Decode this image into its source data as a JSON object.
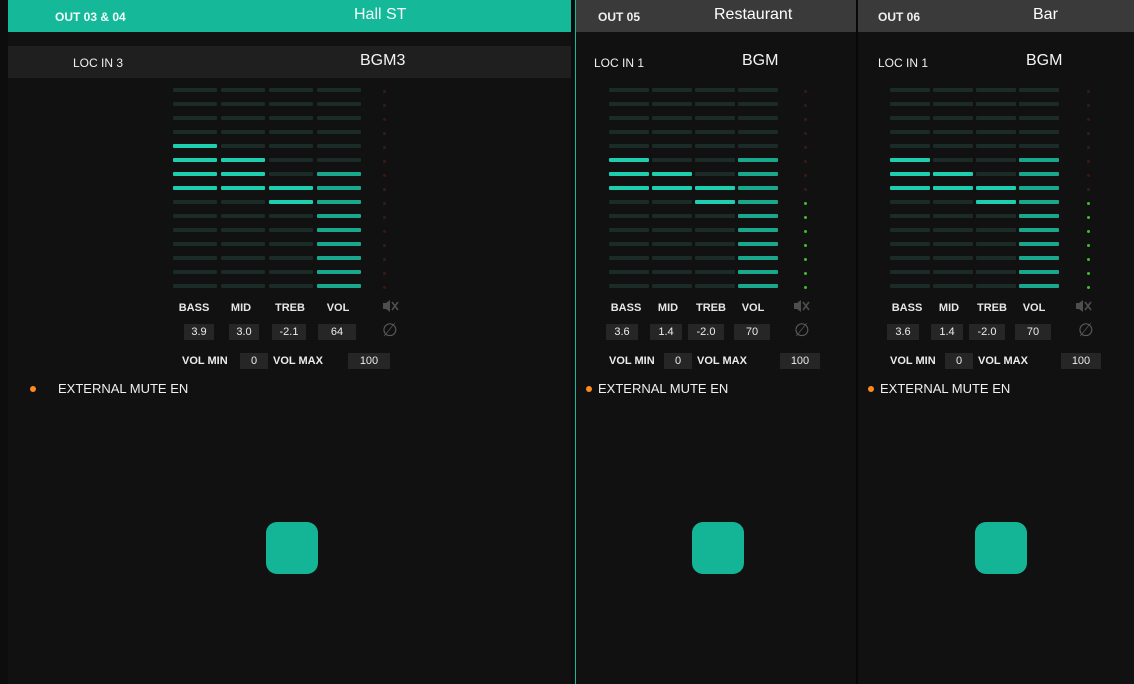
{
  "colors": {
    "accent": "#16b89a",
    "bar_active": "#1dcfae",
    "bar_level": "#19a88d",
    "bar_off": "#1a2b28",
    "led_green": "#3fbf2a",
    "led_off": "#3a1a12",
    "mute_dot": "#ff8a1e"
  },
  "eq_labels": [
    "BASS",
    "MID",
    "TREB",
    "VOL"
  ],
  "vol_min_label": "VOL MIN",
  "vol_max_label": "VOL MAX",
  "ext_mute_label": "EXTERNAL MUTE EN",
  "icons": {
    "mute": "speaker-mute-icon",
    "phase": "phase-invert-icon"
  },
  "zones": [
    {
      "out": "OUT 03 & 04",
      "name": "Hall ST",
      "selected": true,
      "loc_in": "LOC IN 3",
      "source": "BGM3",
      "bass": "3.9",
      "mid": "3.0",
      "treb": "-2.1",
      "vol": "64",
      "vol_min": "0",
      "vol_max": "100",
      "meter_lit": 0
    },
    {
      "out": "OUT 05",
      "name": "Restaurant",
      "selected": false,
      "loc_in": "LOC IN 1",
      "source": "BGM",
      "bass": "3.6",
      "mid": "1.4",
      "treb": "-2.0",
      "vol": "70",
      "vol_min": "0",
      "vol_max": "100",
      "meter_lit": 7
    },
    {
      "out": "OUT 06",
      "name": "Bar",
      "selected": false,
      "loc_in": "LOC IN 1",
      "source": "BGM",
      "bass": "3.6",
      "mid": "1.4",
      "treb": "-2.0",
      "vol": "70",
      "vol_min": "0",
      "vol_max": "100",
      "meter_lit": 7
    }
  ]
}
